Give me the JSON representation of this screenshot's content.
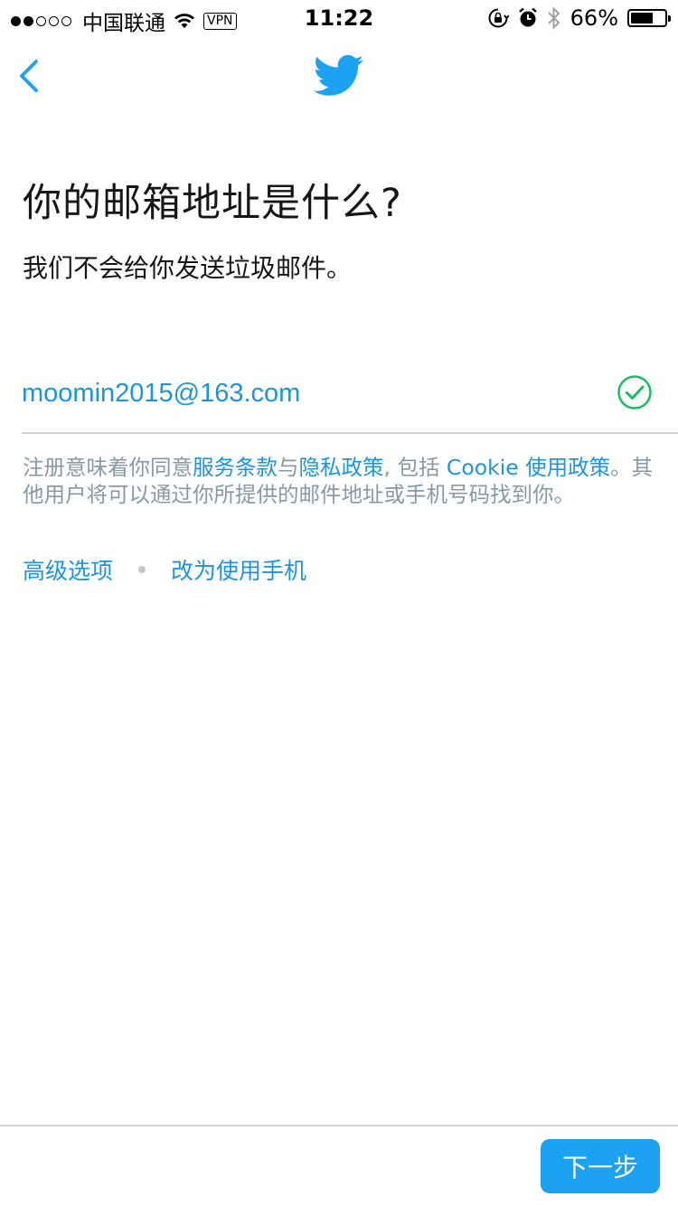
{
  "status_bar": {
    "carrier": "中国联通",
    "vpn": "VPN",
    "time": "11:22",
    "battery_percent": "66%",
    "battery_level": 0.66,
    "signal_bars": 2
  },
  "header": {
    "back_icon": "chevron-left-icon",
    "logo_icon": "twitter-bird-icon"
  },
  "main": {
    "title": "你的邮箱地址是什么?",
    "subtitle": "我们不会给你发送垃圾邮件。",
    "email_value": "moomin2015@163.com",
    "valid_icon": "checkmark-circle-icon",
    "legal": {
      "prefix": "注册意味着你同意",
      "terms_link": "服务条款",
      "and": "与",
      "privacy_link": "隐私政策",
      "including": ", 包括 ",
      "cookie_link": "Cookie 使用政策",
      "suffix": "。其他用户将可以通过你所提供的邮件地址或手机号码找到你。"
    },
    "options": {
      "advanced": "高级选项",
      "use_phone": "改为使用手机"
    }
  },
  "footer": {
    "next_label": "下一步"
  },
  "colors": {
    "accent": "#1da1f2",
    "link": "#1c94e0",
    "valid": "#17bf63",
    "muted_text": "#8899a6",
    "divider": "#cfd5da"
  }
}
